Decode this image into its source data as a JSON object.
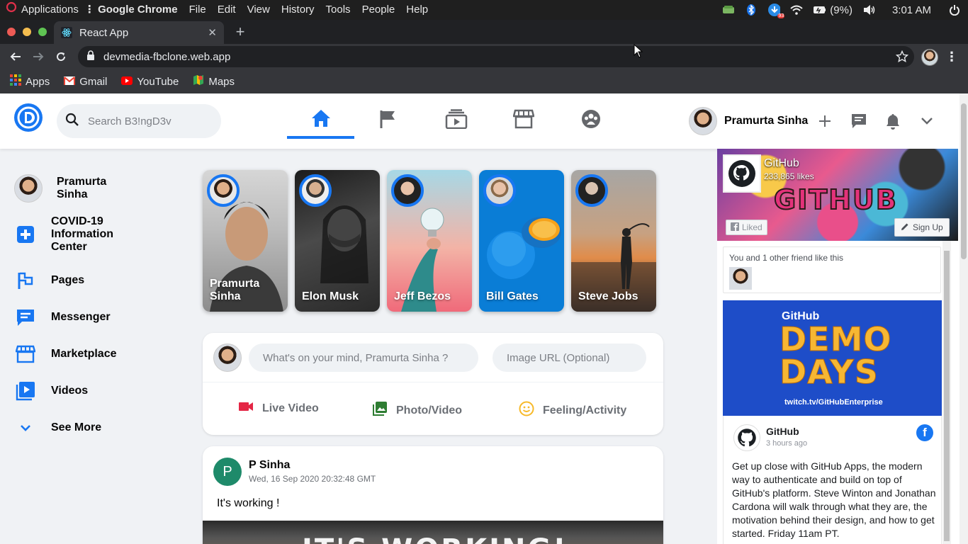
{
  "os": {
    "menu": [
      "Applications",
      "Google Chrome",
      "File",
      "Edit",
      "View",
      "History",
      "Tools",
      "People",
      "Help"
    ],
    "battery": "(9%)",
    "time": "3:01 AM",
    "badge_count": "93"
  },
  "browser": {
    "tab_title": "React App",
    "url": "devmedia-fbclone.web.app",
    "bookmarks": [
      "Apps",
      "Gmail",
      "YouTube",
      "Maps"
    ]
  },
  "header": {
    "search_placeholder": "Search B3!ngD3v",
    "user_name": "Pramurta Sinha"
  },
  "sidebar": {
    "items": [
      {
        "label": "Pramurta Sinha",
        "icon": "user-avatar"
      },
      {
        "label": "COVID-19 Information Center",
        "icon": "plus-icon"
      },
      {
        "label": "Pages",
        "icon": "flag-icon"
      },
      {
        "label": "Messenger",
        "icon": "chat-icon"
      },
      {
        "label": "Marketplace",
        "icon": "store-icon"
      },
      {
        "label": "Videos",
        "icon": "video-icon"
      },
      {
        "label": "See More",
        "icon": "chevron-down-icon"
      }
    ]
  },
  "stories": [
    {
      "name": "Pramurta Sinha"
    },
    {
      "name": "Elon Musk"
    },
    {
      "name": "Jeff Bezos"
    },
    {
      "name": "Bill Gates"
    },
    {
      "name": "Steve Jobs"
    }
  ],
  "composer": {
    "placeholder_text": "What's on your mind, Pramurta Sinha ?",
    "placeholder_image": "Image URL (Optional)",
    "actions": [
      "Live Video",
      "Photo/Video",
      "Feeling/Activity"
    ]
  },
  "post": {
    "avatar_letter": "P",
    "author": "P Sinha",
    "date": "Wed, 16 Sep 2020 20:32:48 GMT",
    "text": "It's working !",
    "image_caption": "IT'S WORKING!"
  },
  "widget": {
    "page_name": "GitHub",
    "likes": "233,865 likes",
    "cover_graffiti": "GITHUB",
    "liked_label": "Liked",
    "signup_label": "Sign Up",
    "friends_text": "You and 1 other friend like this",
    "banner_brand": "GitHub",
    "banner_title_1": "DEMO",
    "banner_title_2": "DAYS",
    "banner_url": "twitch.tv/GitHubEnterprise",
    "fb_glyph": "f",
    "post_author": "GitHub",
    "post_time": "3 hours ago",
    "post_text": "Get up close with GitHub Apps, the modern way to authenticate and build on top of GitHub's platform. Steve Winton and Jonathan Cardona will walk through what they are, the motivation behind their design, and how to get started. Friday 11am PT."
  },
  "colors": {
    "accent": "#1877f2",
    "page_bg": "#f0f2f5",
    "live_video": "#e42645",
    "photo": "#4caf50",
    "feeling": "#f7b928"
  }
}
